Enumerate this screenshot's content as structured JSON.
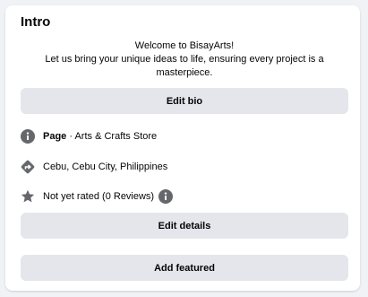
{
  "intro": {
    "title": "Intro",
    "bio_lines": [
      "Welcome to BisayArts!",
      "Let us bring your unique ideas to life, ensuring every project is a",
      "masterpiece."
    ],
    "edit_bio_label": "Edit bio",
    "details": [
      {
        "icon": "info-icon",
        "bold": "Page",
        "text": " · Arts & Crafts Store"
      },
      {
        "icon": "directions-icon",
        "text": "Cebu, Cebu City, Philippines"
      },
      {
        "icon": "star-icon",
        "text": "Not yet rated (0 Reviews)"
      }
    ],
    "edit_details_label": "Edit details",
    "add_featured_label": "Add featured"
  },
  "colors": {
    "button_bg": "#e4e6eb",
    "icon_gray": "#65676b",
    "page_bg": "#f0f2f5"
  }
}
